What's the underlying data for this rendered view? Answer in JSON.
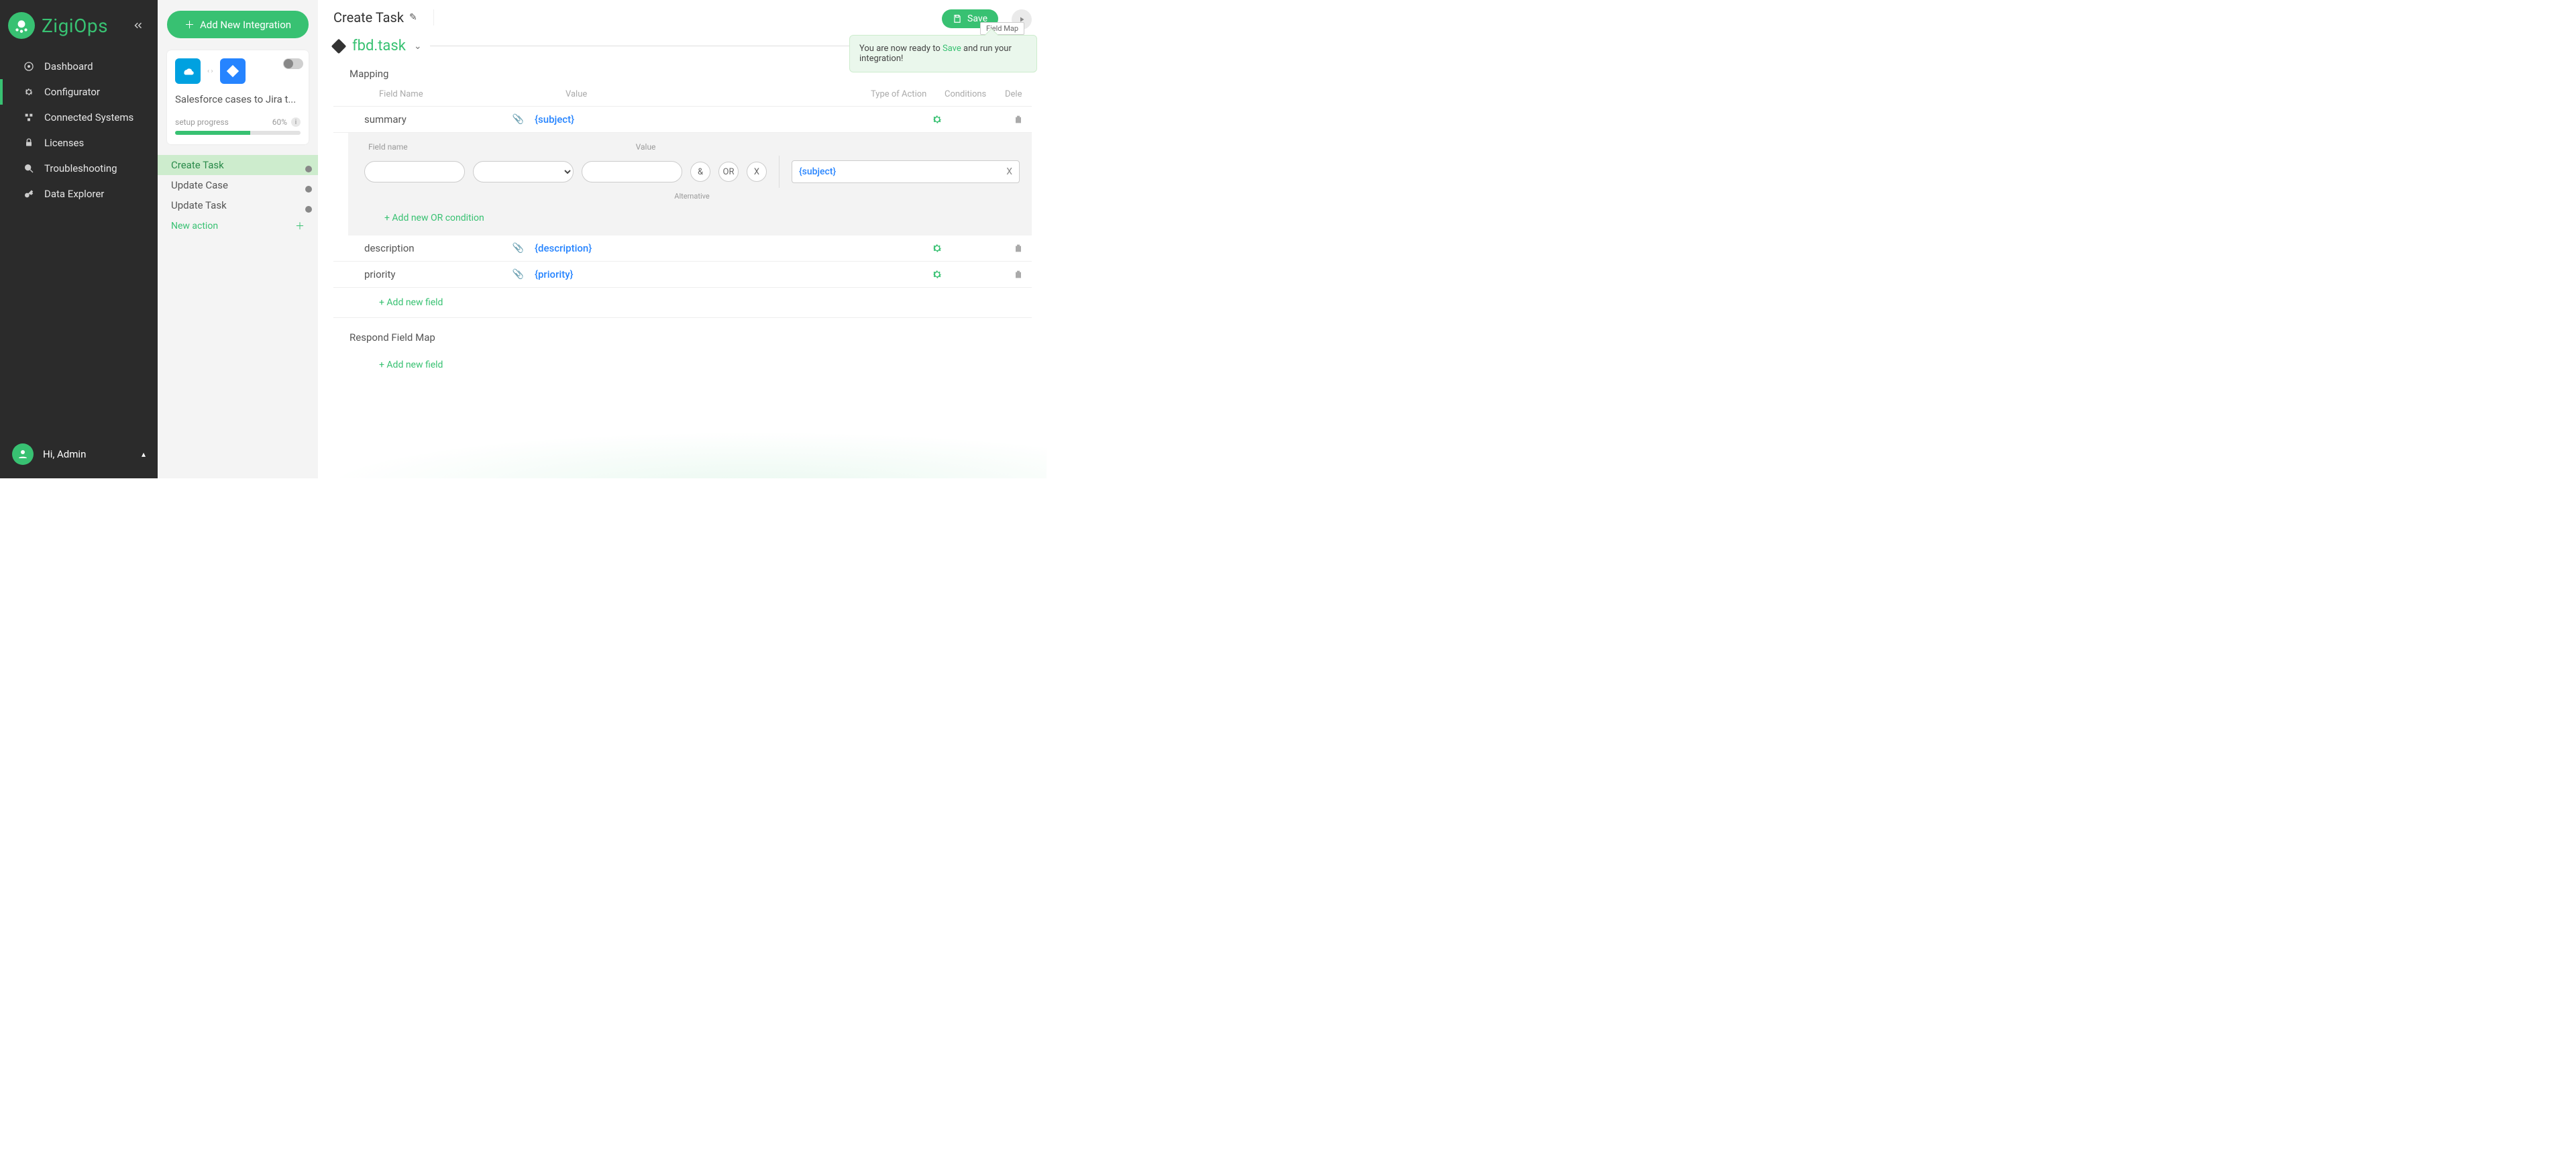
{
  "brand": "ZigiOps",
  "nav": {
    "items": [
      {
        "label": "Dashboard"
      },
      {
        "label": "Configurator"
      },
      {
        "label": "Connected Systems"
      },
      {
        "label": "Licenses"
      },
      {
        "label": "Troubleshooting"
      },
      {
        "label": "Data Explorer"
      }
    ],
    "activeIndex": 1
  },
  "user": {
    "greeting": "Hi, Admin"
  },
  "intpanel": {
    "add_label": "Add New Integration",
    "integration_title": "Salesforce cases to Jira t...",
    "progress_label": "setup progress",
    "progress_value": "60%",
    "actions": [
      {
        "label": "Create Task",
        "active": true
      },
      {
        "label": "Update Case",
        "active": false
      },
      {
        "label": "Update Task",
        "active": false
      }
    ],
    "new_action_label": "New action"
  },
  "main": {
    "title": "Create Task",
    "save_label": "Save",
    "tooltip_tag": "Field Map",
    "tooltip_pre": "You are now ready to ",
    "tooltip_link": "Save",
    "tooltip_post": " and run your integration!",
    "section_title": "fbd.task",
    "mapping_label": "Mapping",
    "cols": {
      "field": "Field Name",
      "value": "Value",
      "type": "Type of Action",
      "cond": "Conditions",
      "del": "Dele"
    },
    "rows": [
      {
        "field": "summary",
        "value": "{subject}"
      },
      {
        "field": "description",
        "value": "{description}"
      },
      {
        "field": "priority",
        "value": "{priority}"
      }
    ],
    "editor": {
      "field_label": "Field name",
      "value_label": "Value",
      "and": "&",
      "or": "OR",
      "x": "X",
      "subject": "{subject}",
      "subject_x": "X",
      "alternative": "Alternative",
      "add_or": "+ Add new OR condition"
    },
    "add_field": "+ Add new field",
    "respond_label": "Respond Field Map",
    "add_field2": "+ Add new field"
  }
}
